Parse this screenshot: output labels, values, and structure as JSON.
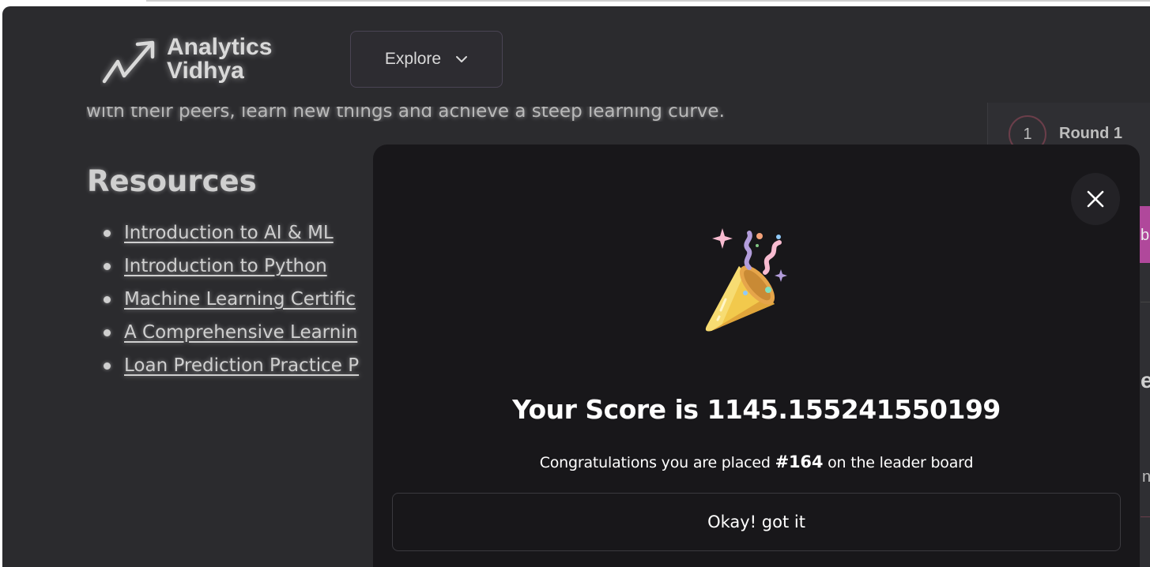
{
  "header": {
    "logo_line1": "Analytics",
    "logo_line2": "Vidhya",
    "explore_label": "Explore"
  },
  "main": {
    "intro_text": "with their peers, learn new things and achieve a steep learning curve.",
    "resources_heading": "Resources",
    "resources": [
      {
        "label": "Introduction to AI & ML"
      },
      {
        "label": "Introduction to Python"
      },
      {
        "label": "Machine Learning Certific"
      },
      {
        "label": "A Comprehensive Learnin"
      },
      {
        "label": "Loan Prediction Practice P"
      }
    ]
  },
  "sidebar": {
    "round_number": "1",
    "round_label": "Round 1",
    "pink_tab_letter": "b",
    "partial_letter_e": "e",
    "partial_letter_n": "n"
  },
  "modal": {
    "score_title": "Your Score is 1145.155241550199",
    "congrats_prefix": "Congratulations you are placed ",
    "rank": "#164",
    "congrats_suffix": " on the leader board",
    "ok_button": "Okay! got it",
    "icon": "party-popper-icon",
    "close_icon": "close-icon"
  },
  "colors": {
    "page_bg": "#2b2b2e",
    "modal_bg": "#18171a",
    "accent_pink": "#b0489b"
  }
}
